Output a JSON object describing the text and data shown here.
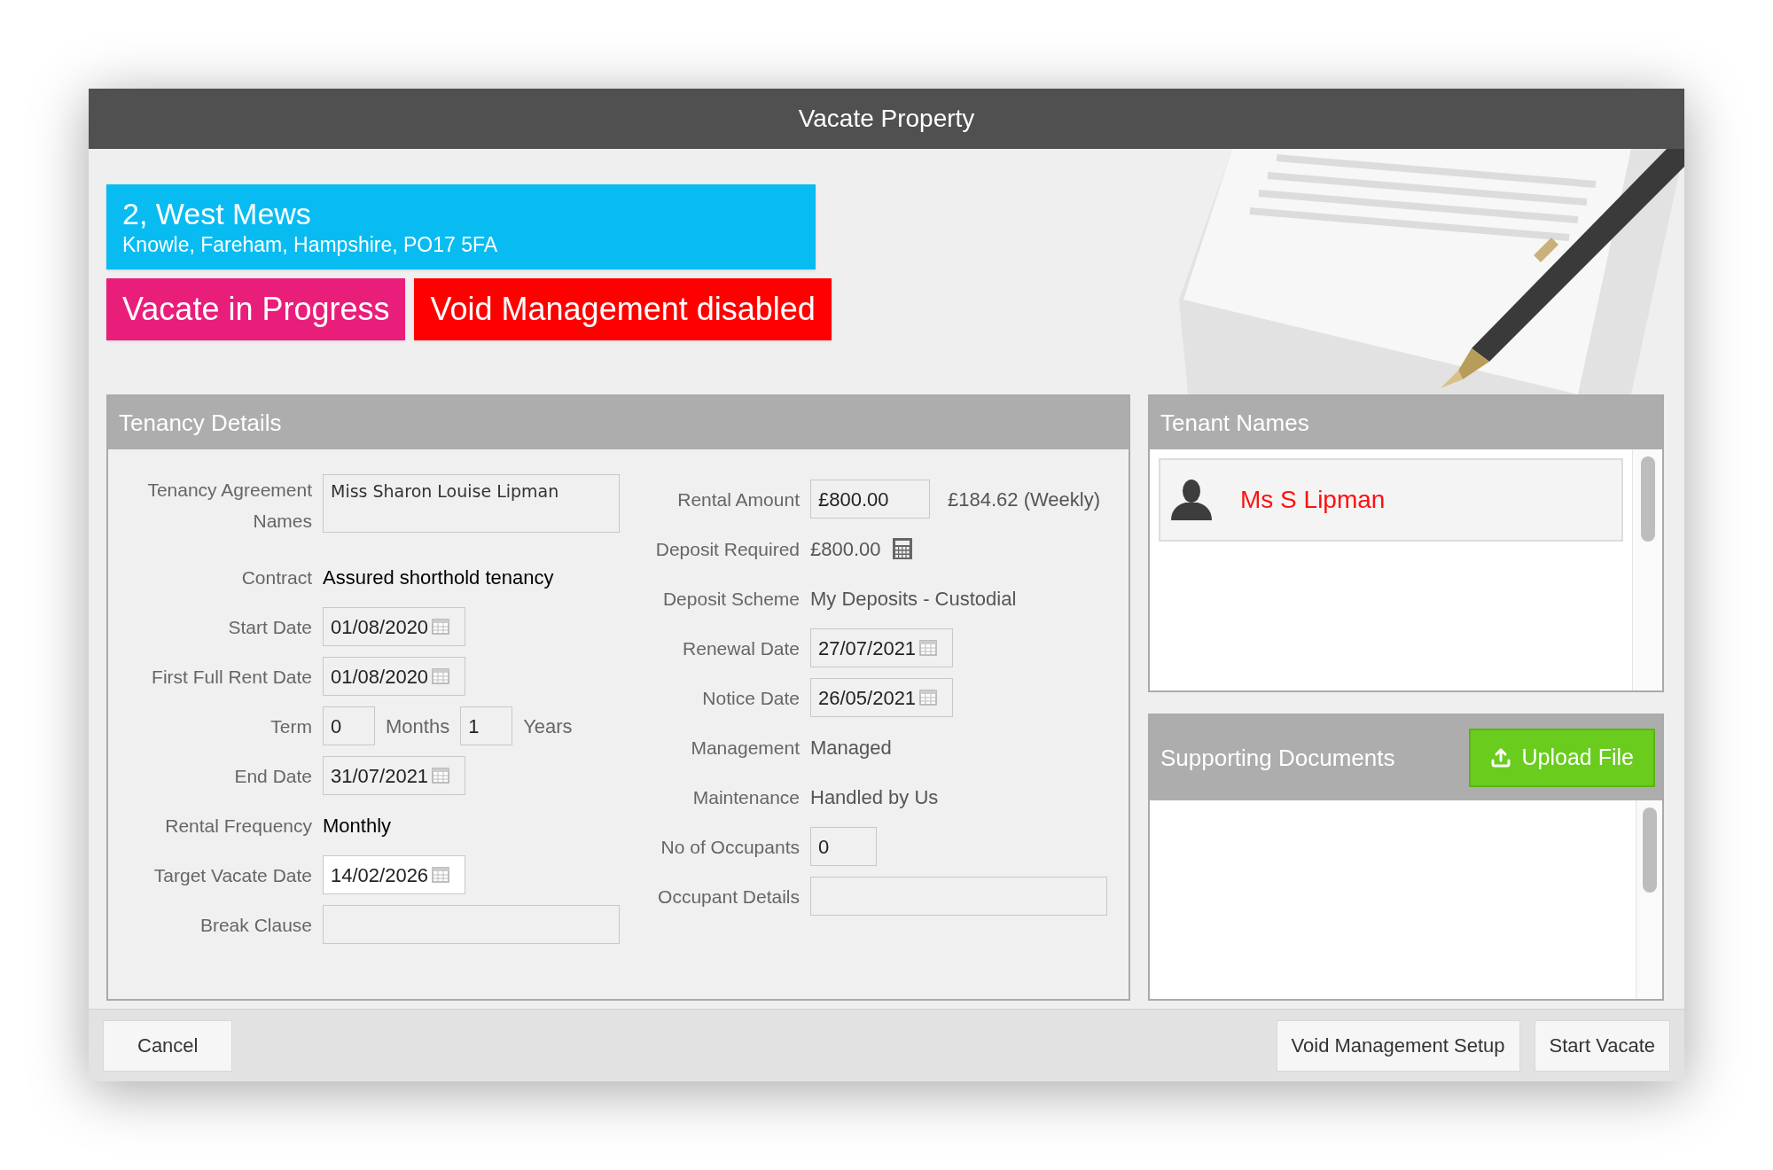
{
  "window": {
    "title": "Vacate Property"
  },
  "property": {
    "address_line_1": "2, West Mews",
    "address_line_2": "Knowle, Fareham, Hampshire, PO17 5FA"
  },
  "status_badges": [
    {
      "label": "Vacate in Progress",
      "color": "#e91e7a"
    },
    {
      "label": "Void Management disabled",
      "color": "#ff0000"
    }
  ],
  "tenancy_details": {
    "title": "Tenancy Details",
    "left_fields": [
      {
        "label": "Tenancy Agreement Names",
        "kind": "textarea",
        "value": "Miss Sharon Louise Lipman",
        "editable": false
      },
      {
        "label": "Contract",
        "kind": "text",
        "value": "Assured shorthold tenancy"
      },
      {
        "label": "Start Date",
        "kind": "date",
        "value": "01/08/2020",
        "editable": false
      },
      {
        "label": "First Full Rent Date",
        "kind": "date",
        "value": "01/08/2020",
        "editable": false
      },
      {
        "label": "Term",
        "kind": "term",
        "parts": [
          {
            "kind": "input",
            "value": "0"
          },
          {
            "kind": "unit",
            "text": "Months"
          },
          {
            "kind": "input",
            "value": "1"
          },
          {
            "kind": "unit",
            "text": "Years"
          }
        ]
      },
      {
        "label": "End Date",
        "kind": "date",
        "value": "31/07/2021",
        "editable": false
      },
      {
        "label": "Rental Frequency",
        "kind": "text",
        "value": "Monthly"
      },
      {
        "label": "Target Vacate Date",
        "kind": "date",
        "value": "14/02/2026",
        "editable": true
      },
      {
        "label": "Break Clause",
        "kind": "wide_input",
        "editable": false
      }
    ],
    "right_fields": [
      {
        "label": "Rental Amount",
        "kind": "input",
        "value": "£800.00",
        "note": "£184.62 (Weekly)",
        "editable": false
      },
      {
        "label": "Deposit Required",
        "kind": "calculator_text",
        "value": "£800.00"
      },
      {
        "label": "Deposit Scheme",
        "kind": "text",
        "value": "My Deposits - Custodial"
      },
      {
        "label": "Renewal Date",
        "kind": "date",
        "value": "27/07/2021",
        "editable": false
      },
      {
        "label": "Notice Date",
        "kind": "date",
        "value": "26/05/2021",
        "editable": false
      },
      {
        "label": "Management",
        "kind": "text",
        "value": "Managed"
      },
      {
        "label": "Maintenance",
        "kind": "text",
        "value": "Handled by Us"
      },
      {
        "label": "No of Occupants",
        "kind": "small_input",
        "value": "0",
        "editable": false
      },
      {
        "label": "Occupant Details",
        "kind": "wide_input",
        "editable": false
      }
    ]
  },
  "tenant_names": {
    "title": "Tenant Names",
    "tenants": [
      {
        "name": "Ms S Lipman"
      }
    ]
  },
  "supporting_documents": {
    "title": "Supporting Documents",
    "upload_button": "Upload File"
  },
  "footer": {
    "left_buttons": [
      "Cancel"
    ],
    "right_buttons": [
      "Void Management Setup",
      "Start Vacate"
    ]
  }
}
